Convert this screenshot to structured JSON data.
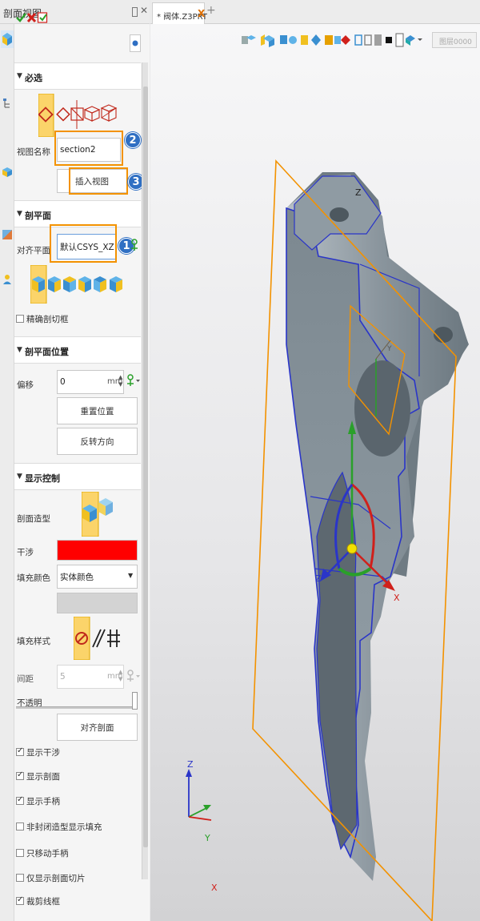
{
  "panel": {
    "title": "剖面视图",
    "close_glyph": "✕",
    "sections": {
      "required": {
        "title": "必选",
        "view_name_label": "视图名称",
        "view_name_value": "section2",
        "insert_view_label": "插入视图"
      },
      "section_plane": {
        "title": "剖平面",
        "align_plane_label": "对齐平面",
        "align_plane_value": "默认CSYS_XZ",
        "precise_label": "精确剖切框"
      },
      "plane_position": {
        "title": "剖平面位置",
        "offset_label": "偏移",
        "offset_value": "0",
        "offset_unit": "mm",
        "reset_label": "重置位置",
        "reverse_label": "反转方向"
      },
      "display": {
        "title": "显示控制",
        "section_model_label": "剖面造型",
        "interference_label": "干涉",
        "interference_color": "#ff0000",
        "fill_color_label": "填充颜色",
        "fill_color_value": "实体颜色",
        "fill_style_label": "填充样式",
        "spacing_label": "间距",
        "spacing_value": "5",
        "spacing_unit": "mm",
        "opacity_label": "不透明",
        "align_section_label": "对齐剖面",
        "checkboxes": [
          {
            "label": "显示干涉",
            "checked": true
          },
          {
            "label": "显示剖面",
            "checked": true
          },
          {
            "label": "显示手柄",
            "checked": true
          },
          {
            "label": "非封闭造型显示填充",
            "checked": false
          },
          {
            "label": "只移动手柄",
            "checked": false
          },
          {
            "label": "仅显示剖面切片",
            "checked": false
          },
          {
            "label": "裁剪线框",
            "checked": true
          }
        ]
      }
    },
    "badges": [
      "2",
      "3",
      "1"
    ]
  },
  "tab": {
    "label": "* 阀体.Z3PRT",
    "close_glyph": "X",
    "add_glyph": "+"
  },
  "viewport": {
    "layer_label": "图层0000",
    "axes": {
      "x": "X",
      "y": "Y",
      "z": "Z"
    }
  },
  "colors": {
    "accent_orange": "#f39200",
    "badge_blue": "#2f6fc3",
    "model_gray": "#7f8b94",
    "edge_blue": "#2a35c8"
  },
  "icons": [
    "pin-icon",
    "close-icon",
    "ok-check-icon",
    "cancel-x-icon",
    "apply-icon",
    "section-view-icon",
    "cube-icons",
    "plane-icons",
    "model-icon"
  ]
}
